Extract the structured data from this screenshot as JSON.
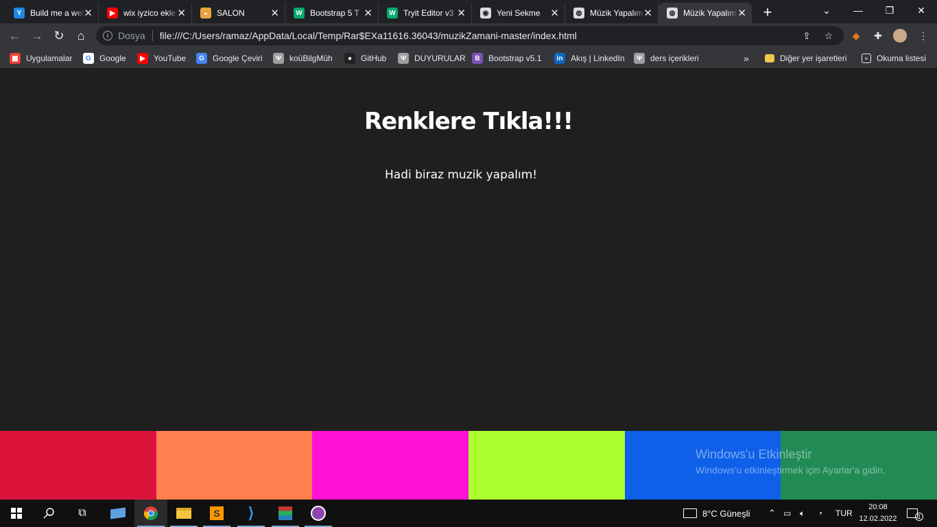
{
  "browser": {
    "tabs": [
      {
        "title": "Build me a web",
        "icon": "yandex-icon",
        "color": "#1e88e5",
        "glyph": "Y"
      },
      {
        "title": "wix iyzico ekle",
        "icon": "youtube-icon",
        "color": "#ff0000",
        "glyph": "▶"
      },
      {
        "title": "SALON",
        "icon": "burger-icon",
        "color": "#e8a33d",
        "glyph": "◒"
      },
      {
        "title": "Bootstrap 5 T",
        "icon": "w3schools-icon",
        "color": "#04aa6d",
        "glyph": "W"
      },
      {
        "title": "Tryit Editor v3",
        "icon": "w3schools-icon",
        "color": "#04aa6d",
        "glyph": "W"
      },
      {
        "title": "Yeni Sekme",
        "icon": "chrome-icon",
        "color": "#dadce0",
        "glyph": "◉"
      },
      {
        "title": "Müzik Yapalım",
        "icon": "globe-icon",
        "color": "#dadce0",
        "glyph": "◍"
      },
      {
        "title": "Müzik Yapalım",
        "icon": "globe-icon",
        "color": "#dadce0",
        "glyph": "◍",
        "active": true
      }
    ],
    "new_tab": "+",
    "address": {
      "scheme_label": "Dosya",
      "url": "file:///C:/Users/ramaz/AppData/Local/Temp/Rar$EXa11616.36043/muzikZamani-master/index.html"
    },
    "bookmarks": [
      {
        "label": "Uygulamalar",
        "icon": "apps-grid-icon",
        "color": "#ea4335",
        "glyph": "▦"
      },
      {
        "label": "Google",
        "icon": "google-icon",
        "color": "#ffffff",
        "glyph": "G"
      },
      {
        "label": "YouTube",
        "icon": "youtube-icon",
        "color": "#ff0000",
        "glyph": "▶"
      },
      {
        "label": "Google Çeviri",
        "icon": "translate-icon",
        "color": "#4285f4",
        "glyph": "G"
      },
      {
        "label": "koüBilgMüh",
        "icon": "kou-icon",
        "color": "#9e9e9e",
        "glyph": "Ψ"
      },
      {
        "label": "GitHub",
        "icon": "github-icon",
        "color": "#222222",
        "glyph": "●"
      },
      {
        "label": "DUYURULAR",
        "icon": "kou-icon",
        "color": "#9e9e9e",
        "glyph": "Ψ"
      },
      {
        "label": "Bootstrap v5.1",
        "icon": "bootstrap-icon",
        "color": "#7952b3",
        "glyph": "B"
      },
      {
        "label": "Akış | LinkedIn",
        "icon": "linkedin-icon",
        "color": "#0a66c2",
        "glyph": "in"
      },
      {
        "label": "ders içerikleri",
        "icon": "kou-icon",
        "color": "#9e9e9e",
        "glyph": "Ψ"
      }
    ],
    "bookmarks_more": "»",
    "other_bookmarks": "Diğer yer işaretleri",
    "reading_list": "Okuma listesi"
  },
  "page": {
    "title": "Renklere Tıkla!!!",
    "subtitle": "Hadi biraz muzik yapalım!",
    "colors": [
      "#dc143c",
      "#ff7f50",
      "#ff12d5",
      "#adff2f",
      "#0e60e8",
      "#228b55"
    ],
    "watermark_title": "Windows'u Etkinleştir",
    "watermark_text": "Windows'u etkinleştirmek için Ayarlar'a gidin."
  },
  "taskbar": {
    "weather": "8°C  Güneşli",
    "language": "TUR",
    "time": "20:08",
    "date": "12.02.2022",
    "notification_count": "1"
  }
}
